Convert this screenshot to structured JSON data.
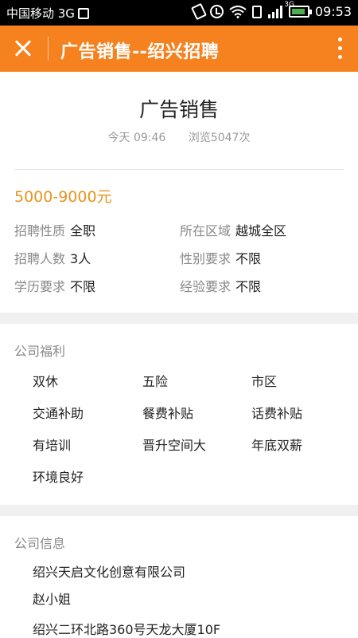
{
  "status_bar": {
    "carrier": "中国移动 3G",
    "network": "3G",
    "time": "09:53"
  },
  "header": {
    "title": "广告销售--绍兴招聘"
  },
  "job": {
    "title": "广告销售",
    "posted": "今天 09:46",
    "views": "浏览5047次",
    "salary": "5000-9000元",
    "details": [
      {
        "label": "招聘性质",
        "value": "全职"
      },
      {
        "label": "所在区域",
        "value": "越城全区"
      },
      {
        "label": "招聘人数",
        "value": "3人"
      },
      {
        "label": "性别要求",
        "value": "不限"
      },
      {
        "label": "学历要求",
        "value": "不限"
      },
      {
        "label": "经验要求",
        "value": "不限"
      }
    ]
  },
  "welfare": {
    "title": "公司福利",
    "items": [
      "双休",
      "五险",
      "市区",
      "交通补助",
      "餐费补贴",
      "话费补贴",
      "有培训",
      "晋升空间大",
      "年底双薪",
      "环境良好"
    ]
  },
  "company": {
    "title": "公司信息",
    "name": "绍兴天启文化创意有限公司",
    "contact": "赵小姐",
    "address": "绍兴二环北路360号天龙大厦10F"
  },
  "colors": {
    "header_bg": "#f6821f",
    "salary": "#e5941f"
  }
}
